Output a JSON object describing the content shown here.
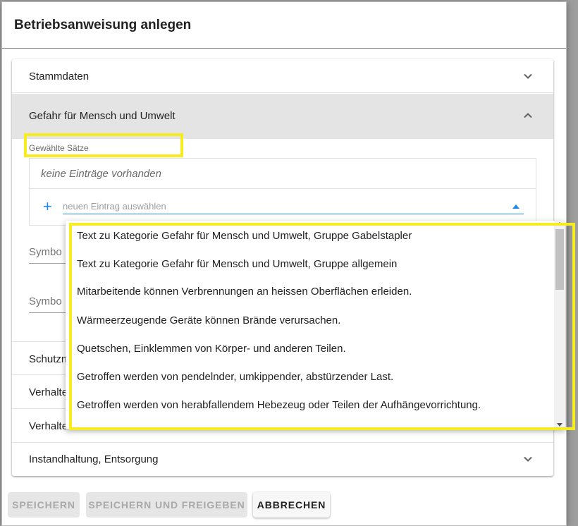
{
  "dialog": {
    "title": "Betriebsanweisung anlegen"
  },
  "accordion": {
    "stammdaten": "Stammdaten",
    "gefahr": "Gefahr für Mensch und Umwelt",
    "schutz": "Schutzm",
    "verhalten1": "Verhalte",
    "verhalten2": "Verhalte",
    "instandhaltung": "Instandhaltung, Entsorgung"
  },
  "gefahr_panel": {
    "field_label": "Gewählte Sätze",
    "empty_text": "keine Einträge vorhanden",
    "input_placeholder": "neuen Eintrag auswählen",
    "input_value": "",
    "symbol_label_1": "Symbo",
    "symbol_label_2": "Symbo"
  },
  "dropdown": {
    "options": [
      "Text zu Kategorie Gefahr für Mensch und Umwelt, Gruppe Gabelstapler",
      "Text zu Kategorie Gefahr für Mensch und Umwelt, Gruppe allgemein",
      "Mitarbeitende können Verbrennungen an heissen Oberflächen erleiden.",
      "Wärmeerzeugende Geräte können Brände verursachen.",
      "Quetschen, Einklemmen von Körper- und anderen Teilen.",
      "Getroffen werden von pendelnder, umkippender, abstürzender Last.",
      "Getroffen werden von herabfallendem Hebezeug oder Teilen der Aufhängevorrichtung."
    ]
  },
  "buttons": {
    "save": "SPEICHERN",
    "save_release": "SPEICHERN UND FREIGEBEN",
    "cancel": "ABBRECHEN"
  },
  "colors": {
    "accent": "#1e88e5",
    "highlight": "#f6ec1f",
    "header_open_bg": "#e4e4e4"
  },
  "icons": {
    "expand": "chevron-down-icon",
    "collapse": "chevron-up-icon",
    "add": "plus-icon",
    "dropdown": "caret-up-icon"
  }
}
